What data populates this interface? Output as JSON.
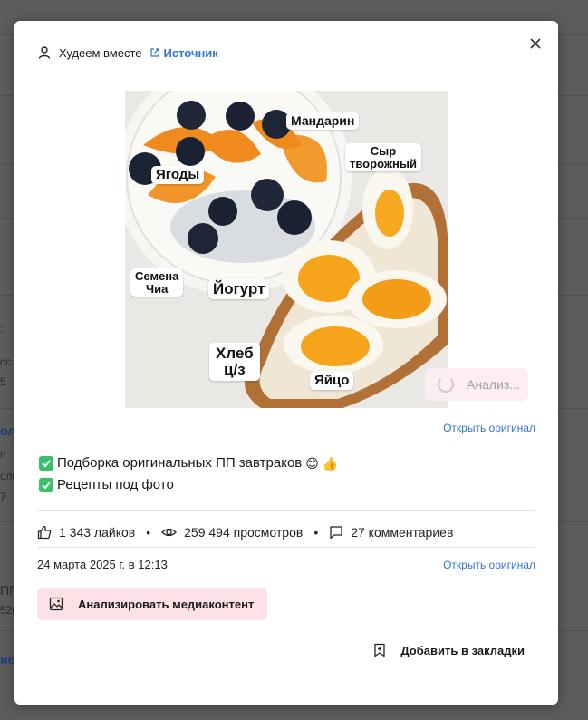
{
  "header": {
    "author": "Худеем вместе",
    "source_label": "Источник"
  },
  "photo": {
    "labels": {
      "mandarin": "Мандарин",
      "cheese_line1": "Сыр",
      "cheese_line2": "творожный",
      "berries": "Ягоды",
      "chia_line1": "Семена",
      "chia_line2": "Чиа",
      "yogurt": "Йогурт",
      "bread_line1": "Хлеб",
      "bread_line2": "ц/з",
      "egg": "Яйцо"
    },
    "analyze_label": "Анализ..."
  },
  "open_original_label": "Открыть оригинал",
  "description": {
    "line1": "Подборка оригинальных ПП завтраков",
    "line1_emojis": "😊 👍",
    "line2": "Рецепты под фото"
  },
  "stats": {
    "likes": "1 343 лайков",
    "views": "259 494 просмотров",
    "comments": "27 комментариев"
  },
  "date": "24 марта 2025 г. в 12:13",
  "actions": {
    "analyze_media": "Анализировать медиаконтент",
    "add_bookmark": "Добавить в закладки"
  },
  "background_fragments": {
    "f1": ":",
    "f2": "сс",
    "f3": "5",
    "f4": "ол",
    "f5": "n",
    "f6": "оло",
    "f7": "7",
    "f8": "ПП",
    "f9": "520",
    "f10": "ие"
  },
  "colors": {
    "link": "#2f73d8",
    "check": "#3bbf6a",
    "media_button_bg": "#fde1e6",
    "overlay": "#5c5c5c"
  }
}
